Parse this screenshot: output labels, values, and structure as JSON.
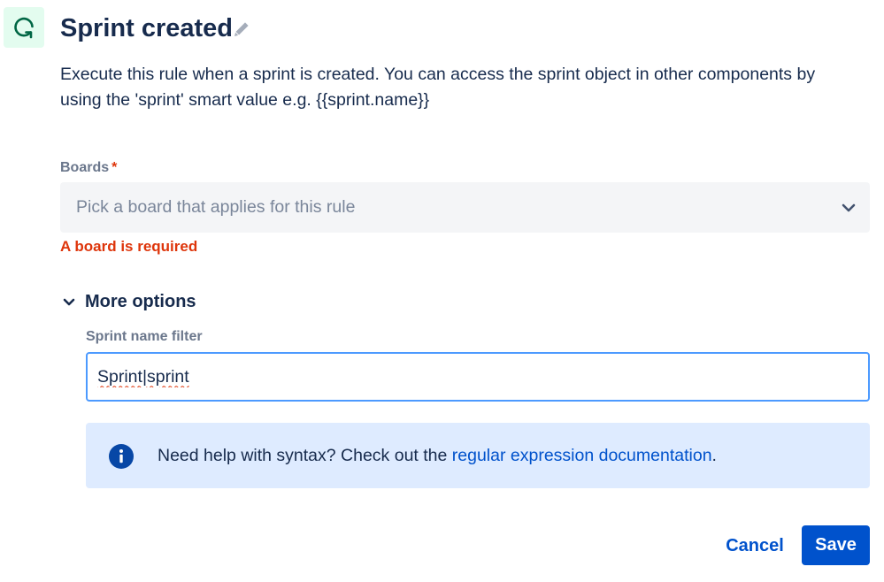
{
  "header": {
    "title": "Sprint created",
    "icon": "sprint-cycle-icon",
    "edit_icon": "pencil-icon"
  },
  "description": "Execute this rule when a sprint is created. You can access the sprint object in other components by using the 'sprint' smart value e.g. {{sprint.name}}",
  "boards": {
    "label": "Boards",
    "required_marker": "*",
    "placeholder": "Pick a board that applies for this rule",
    "error": "A board is required",
    "dropdown_icon": "chevron-down-icon"
  },
  "more_options": {
    "label": "More options",
    "expanded": true,
    "sprint_name_filter": {
      "label": "Sprint name filter",
      "value": "Sprint|sprint"
    }
  },
  "info_panel": {
    "icon": "info-icon",
    "text_before": "Need help with syntax? Check out the ",
    "link_text": "regular expression documentation",
    "text_after": "."
  },
  "actions": {
    "cancel_label": "Cancel",
    "save_label": "Save"
  },
  "colors": {
    "primary": "#0052cc",
    "error": "#de350b",
    "info_background": "#deebff",
    "icon_background": "#e3fcef",
    "icon_accent": "#006644",
    "focus_border": "#4c9aff"
  }
}
